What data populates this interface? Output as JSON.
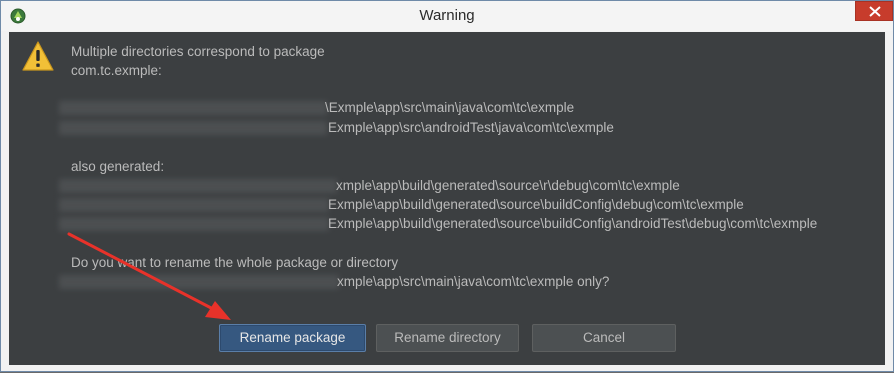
{
  "window": {
    "title": "Warning"
  },
  "message": {
    "line1": "Multiple directories correspond to package",
    "line2": "com.tc.exmple:",
    "paths": [
      "\\Exmple\\app\\src\\main\\java\\com\\tc\\exmple",
      "Exmple\\app\\src\\androidTest\\java\\com\\tc\\exmple"
    ],
    "also_generated_label": "also generated:",
    "generated_paths": [
      "xmple\\app\\build\\generated\\source\\r\\debug\\com\\tc\\exmple",
      "Exmple\\app\\build\\generated\\source\\buildConfig\\debug\\com\\tc\\exmple",
      "Exmple\\app\\build\\generated\\source\\buildConfig\\androidTest\\debug\\com\\tc\\exmple"
    ],
    "question": "Do you want to rename the whole package or directory",
    "question_path": "xmple\\app\\src\\main\\java\\com\\tc\\exmple only?"
  },
  "buttons": {
    "rename_package": "Rename package",
    "rename_directory": "Rename directory",
    "cancel": "Cancel"
  },
  "icons": {
    "app": "android-studio-icon",
    "warning": "warning-icon",
    "close": "close-icon"
  },
  "colors": {
    "dialog_bg": "#3c3f41",
    "default_button": "#365880",
    "annotation_arrow": "#e8322a"
  }
}
